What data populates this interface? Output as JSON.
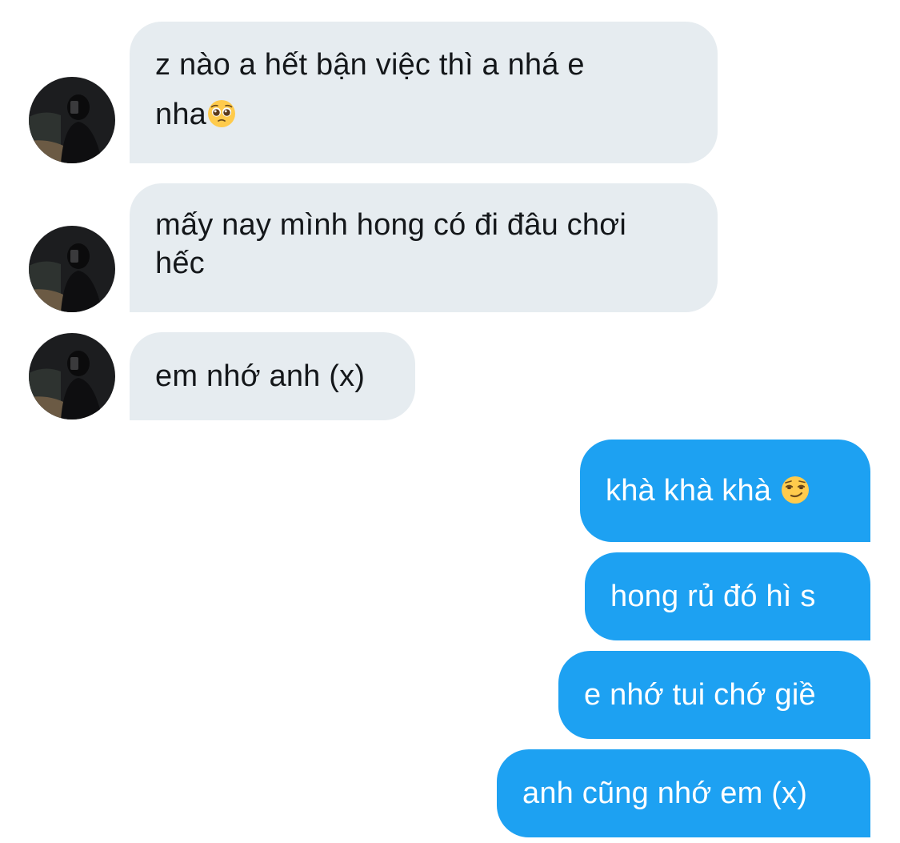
{
  "conversation": {
    "messages": [
      {
        "direction": "received",
        "text": "z nào a hết bận việc thì a nhá e nha",
        "emoji": "pleading-face"
      },
      {
        "direction": "received",
        "text": "mấy nay mình hong có đi đâu chơi hếc"
      },
      {
        "direction": "received",
        "text": "em nhớ anh (x)"
      },
      {
        "direction": "sent",
        "text": "khà khà khà",
        "emoji": "smirking-face"
      },
      {
        "direction": "sent",
        "text": "hong rủ đó hì s"
      },
      {
        "direction": "sent",
        "text": "e nhớ tui chớ giề"
      },
      {
        "direction": "sent",
        "text": "anh cũng nhớ em (x)"
      }
    ]
  },
  "colors": {
    "received_bubble": "#e6ecf0",
    "received_text": "#14171a",
    "sent_bubble": "#1da1f2",
    "sent_text": "#ffffff"
  },
  "text_runs": {
    "msg1_line1": "z nào a hết bận việc thì a nhá e",
    "msg1_line2": "nha",
    "msg2_line1": "mấy nay mình hong có đi đâu chơi",
    "msg2_line2": "hếc",
    "msg3": "em nhớ anh (x)",
    "msg4": "khà khà khà ",
    "msg5": "hong rủ đó hì s",
    "msg6": "e nhớ tui chớ giề",
    "msg7": "anh cũng nhớ em (x)"
  }
}
